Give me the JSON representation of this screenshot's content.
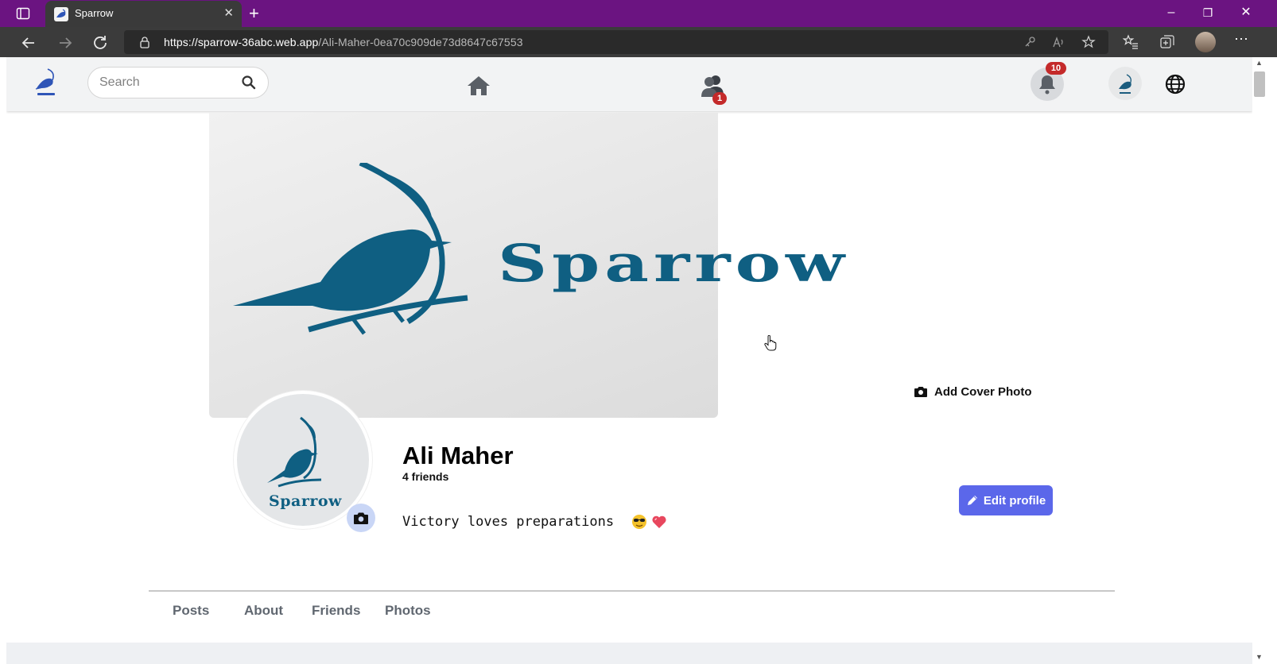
{
  "browser": {
    "tab_title": "Sparrow",
    "url_host": "https://sparrow-36abc.web.app",
    "url_path": "/Ali-Maher-0ea70c909de73d8647c67553"
  },
  "header": {
    "search_placeholder": "Search",
    "notifications_badge": "10",
    "friends_badge": "1"
  },
  "cover": {
    "wordmark": "Sparrow",
    "add_cover_label": "Add Cover Photo"
  },
  "profile": {
    "avatar_wordmark": "Sparrow",
    "name": "Ali Maher",
    "friends": "4 friends",
    "bio": "Victory loves preparations",
    "edit_label": "Edit profile"
  },
  "tabs": [
    "Posts",
    "About",
    "Friends",
    "Photos"
  ],
  "colors": {
    "titlebar": "#6b1481",
    "brand_blue": "#0f5f82",
    "edit_button": "#5b67ea",
    "badge": "#c42a2a"
  }
}
